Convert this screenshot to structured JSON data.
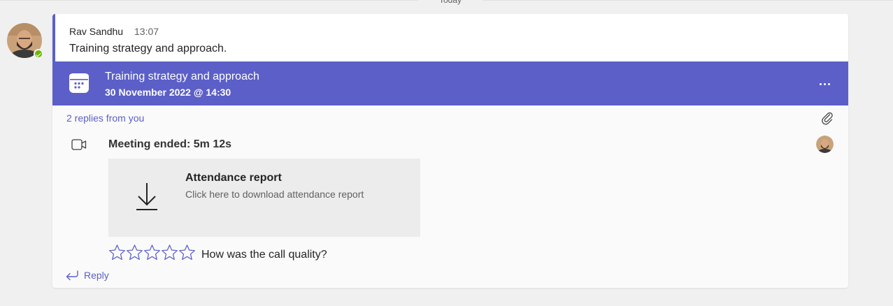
{
  "day_divider": {
    "label": "Today"
  },
  "message": {
    "author": "Rav Sandhu",
    "time": "13:07",
    "text": "Training strategy and approach.",
    "presence": "available"
  },
  "meeting_banner": {
    "title": "Training strategy and approach",
    "subtitle": "30 November 2022 @ 14:30",
    "icon": "calendar-icon",
    "more_icon": "more-options-icon"
  },
  "thread": {
    "replies_label": "2 replies from you",
    "attachment_icon": "paperclip-icon"
  },
  "meeting_ended": {
    "label": "Meeting ended: 5m 12s",
    "icon": "video-camera-icon"
  },
  "attendance_report": {
    "title": "Attendance report",
    "subtitle": "Click here to download attendance report",
    "icon": "download-icon"
  },
  "rating": {
    "stars": 5,
    "selected": 0,
    "question": "How was the call quality?"
  },
  "reply": {
    "label": "Reply",
    "icon": "reply-arrow-icon"
  },
  "colors": {
    "accent": "#5b5fc7",
    "background": "#f0f0f0",
    "card": "#fafafa",
    "presence_available": "#6bb700"
  }
}
